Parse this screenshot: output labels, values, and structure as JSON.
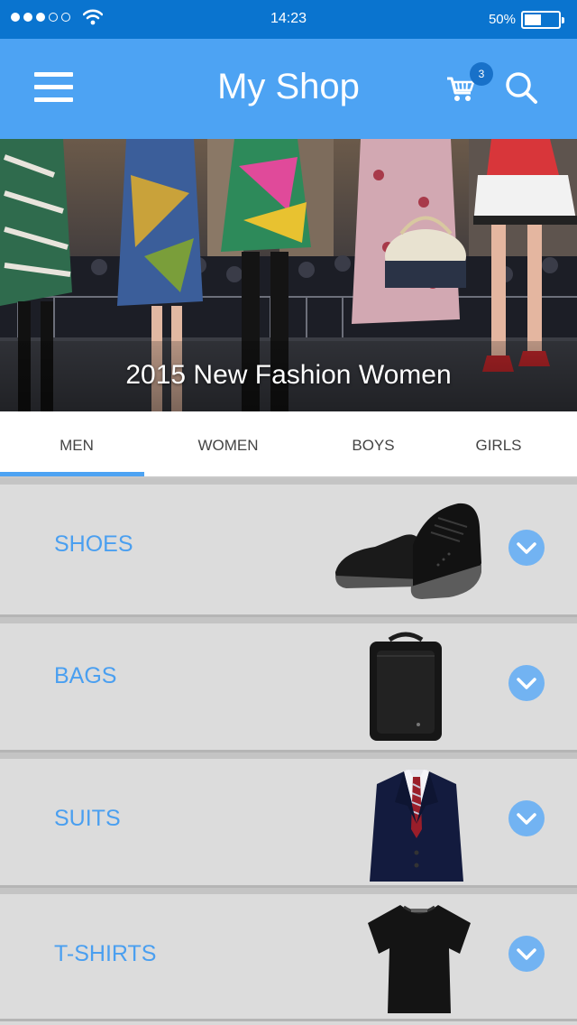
{
  "status_bar": {
    "time": "14:23",
    "battery_percent": "50%",
    "battery_level": 0.5,
    "signal_strength": 3,
    "signal_max": 5
  },
  "header": {
    "title": "My Shop",
    "cart_count": "3",
    "icons": [
      "menu-icon",
      "cart-icon",
      "search-icon"
    ]
  },
  "banner": {
    "caption": "2015 New Fashion Women"
  },
  "tabs": [
    {
      "label": "MEN",
      "selected": true
    },
    {
      "label": "WOMEN",
      "selected": false
    },
    {
      "label": "BOYS",
      "selected": false
    },
    {
      "label": "GIRLS",
      "selected": false
    }
  ],
  "categories": [
    {
      "label": "SHOES",
      "image": "shoe-image"
    },
    {
      "label": "BAGS",
      "image": "backpack-image"
    },
    {
      "label": "SUITS",
      "image": "suit-image"
    },
    {
      "label": "T-SHIRTS",
      "image": "tshirt-image"
    }
  ],
  "colors": {
    "status_bar": "#0a74cf",
    "header": "#4da3f3",
    "accent": "#4a9ff0",
    "cart_badge": "#1871c9",
    "list_background": "#dcdcdc"
  }
}
